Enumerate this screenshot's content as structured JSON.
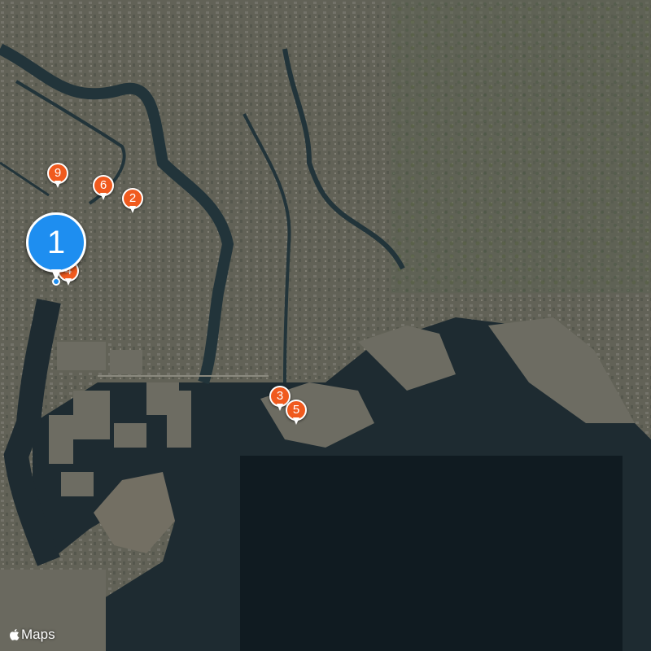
{
  "map": {
    "style": "satellite",
    "colors": {
      "land": "#5a5d52",
      "urban": "#6b6a60",
      "water": "#1d2a30",
      "deep_water": "#0f1a20",
      "river": "#1f3036",
      "pin_primary": "#1e8ef0",
      "pin_secondary": "#f05a1e"
    }
  },
  "pins": {
    "p1": {
      "label": "1",
      "type": "primary"
    },
    "p2": {
      "label": "2",
      "type": "secondary"
    },
    "p3": {
      "label": "3",
      "type": "secondary"
    },
    "p4": {
      "label": "4",
      "type": "secondary"
    },
    "p5": {
      "label": "5",
      "type": "secondary"
    },
    "p6": {
      "label": "6",
      "type": "secondary"
    },
    "p9": {
      "label": "9",
      "type": "secondary"
    }
  },
  "attribution": {
    "icon": "apple-logo-icon",
    "text": "Maps"
  }
}
